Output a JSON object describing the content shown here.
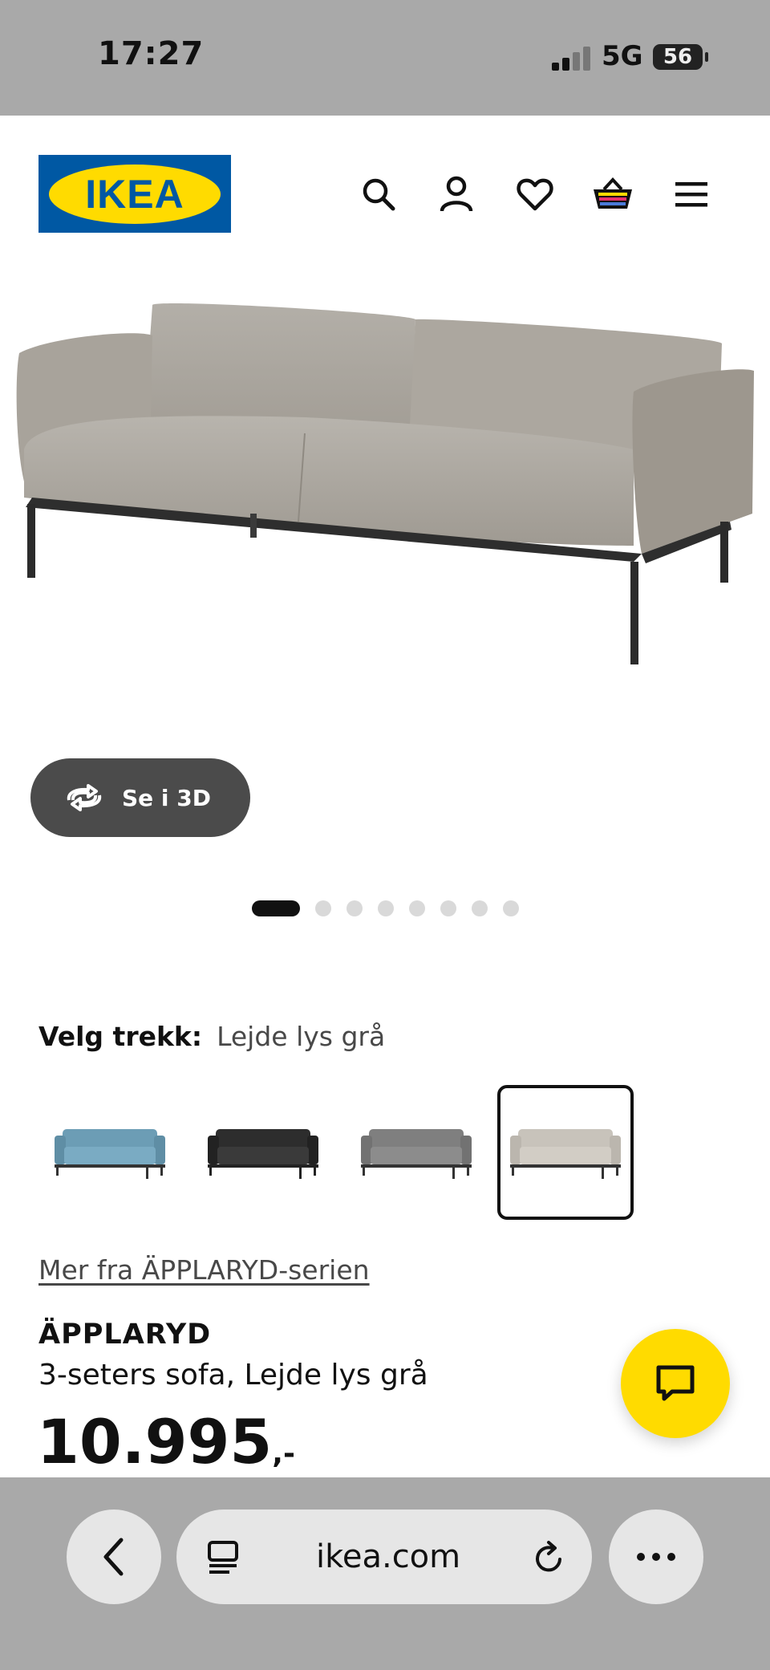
{
  "status_bar": {
    "time": "17:27",
    "network": "5G",
    "battery": "56"
  },
  "header": {
    "logo_text": "IKEA",
    "icons": [
      "search-icon",
      "account-icon",
      "heart-icon",
      "basket-icon",
      "menu-icon"
    ]
  },
  "gallery": {
    "button_3d_label": "Se i 3D",
    "page_count": 8,
    "active_page": 1
  },
  "color_picker": {
    "label": "Velg trekk:",
    "selected_value": "Lejde lys grå",
    "swatches": [
      "blue",
      "black",
      "dark grey",
      "light grey"
    ],
    "selected_index": 3
  },
  "product": {
    "series_link": "Mer fra ÄPPLARYD-serien",
    "name": "ÄPPLARYD",
    "description": "3-seters sofa, Lejde lys grå",
    "price": "10.995",
    "price_suffix": ",-"
  },
  "browser": {
    "url": "ikea.com"
  },
  "colors": {
    "brand_blue": "#0058a3",
    "brand_yellow": "#ffdb00",
    "button_dark": "#4b4b4b"
  }
}
